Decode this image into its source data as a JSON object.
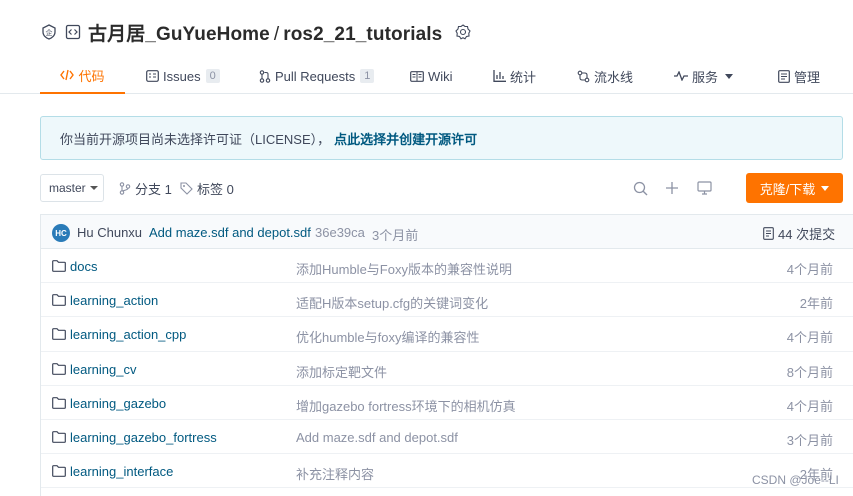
{
  "repo": {
    "owner": "古月居_GuYueHome",
    "separator": "/",
    "name": "ros2_21_tutorials"
  },
  "tabs": [
    {
      "label": "代码",
      "icon": "code-icon",
      "active": true
    },
    {
      "label": "Issues",
      "icon": "issues-icon",
      "count": "0"
    },
    {
      "label": "Pull Requests",
      "icon": "pull-request-icon",
      "count": "1"
    },
    {
      "label": "Wiki",
      "icon": "wiki-icon"
    },
    {
      "label": "统计",
      "icon": "stats-icon"
    },
    {
      "label": "流水线",
      "icon": "pipeline-icon"
    },
    {
      "label": "服务",
      "icon": "service-icon"
    },
    {
      "label": "管理",
      "icon": "manage-icon"
    }
  ],
  "license_notice": {
    "text": "你当前开源项目尚未选择许可证（LICENSE），",
    "link": "点此选择并创建开源许可"
  },
  "toolbar": {
    "branch": "master",
    "branches": "分支 1",
    "tags": "标签 0",
    "clone_label": "克隆/下载"
  },
  "latest_commit": {
    "avatar_initials": "HC",
    "author": "Hu Chunxu",
    "message": "Add maze.sdf and depot.sdf",
    "sha": "36e39ca",
    "time": "3个月前",
    "commit_count": "44 次提交"
  },
  "files": [
    {
      "name": "docs",
      "message": "添加Humble与Foxy版本的兼容性说明",
      "time": "4个月前"
    },
    {
      "name": "learning_action",
      "message": "适配H版本setup.cfg的关键词变化",
      "time": "2年前"
    },
    {
      "name": "learning_action_cpp",
      "message": "优化humble与foxy编译的兼容性",
      "time": "4个月前"
    },
    {
      "name": "learning_cv",
      "message": "添加标定靶文件",
      "time": "8个月前"
    },
    {
      "name": "learning_gazebo",
      "message": "增加gazebo fortress环境下的相机仿真",
      "time": "4个月前"
    },
    {
      "name": "learning_gazebo_fortress",
      "message": "Add maze.sdf and depot.sdf",
      "time": "3个月前"
    },
    {
      "name": "learning_interface",
      "message": "补充注释内容",
      "time": "2年前"
    }
  ],
  "watermark": "CSDN @Joe--LI",
  "colors": {
    "accent": "#fe7300",
    "link": "#005980",
    "muted": "#8c92a4",
    "notice_bg": "#eef8fb"
  }
}
